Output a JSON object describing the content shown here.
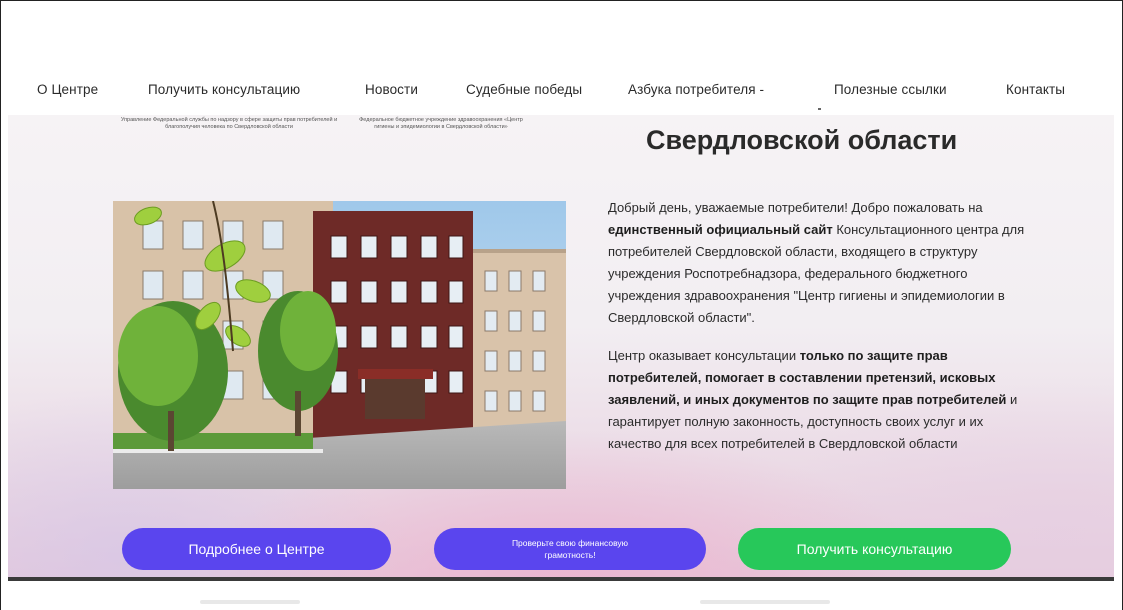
{
  "nav": {
    "items": [
      {
        "label": "О Центре"
      },
      {
        "label": "Получить консультацию"
      },
      {
        "label": "Новости"
      },
      {
        "label": "Судебные победы"
      },
      {
        "label": "Азбука потребителя -"
      },
      {
        "label": "Полезные ссылки"
      },
      {
        "label": "Контакты"
      }
    ]
  },
  "header": {
    "org1": "Управление Федеральной службы по надзору в сфере защиты прав потребителей и благополучия человека по Свердловской области",
    "org2": "Федеральное бюджетное учреждение здравоохранения «Центр гигиены и эпидемиологии в Свердловской области»",
    "region_title": "Свердловской области"
  },
  "intro": {
    "p1_a": "Добрый день, уважаемые потребители! Добро пожаловать на ",
    "p1_b": "единственный официальный сайт",
    "p1_c": " Консультационного центра для потребителей Свердловской области, входящего в структуру учреждения Роспотребнадзора, федерального бюджетного учреждения здравоохранения \"Центр гигиены и эпидемиологии в Свердловской области\".",
    "p2_a": "Центр оказывает консультации ",
    "p2_b": "только по защите прав потребителей, помогает в составлении претензий, исковых заявлений, и иных документов по защите прав потребителей",
    "p2_c": " и гарантирует полную законность, доступность своих услуг и их качество для всех потребителей в Свердловской области"
  },
  "buttons": {
    "about": "Подробнее о Центре",
    "financial": "Проверьте свою финансовую грамотность!",
    "consult": "Получить консультацию"
  },
  "colors": {
    "primary_button": "#5a45ee",
    "consult_button": "#27c85a"
  }
}
